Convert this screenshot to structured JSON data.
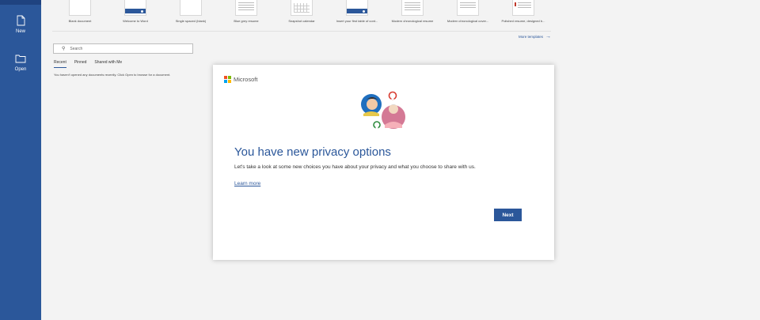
{
  "rail": {
    "items": [
      {
        "label": "New",
        "icon": "new-document-icon"
      },
      {
        "label": "Open",
        "icon": "folder-icon"
      }
    ]
  },
  "templates": {
    "items": [
      {
        "name": "Blank document"
      },
      {
        "name": "Welcome to Word"
      },
      {
        "name": "Single spaced (blank)"
      },
      {
        "name": "Blue grey resume"
      },
      {
        "name": "Snapshot calendar"
      },
      {
        "name": "Insert your first table of cont..."
      },
      {
        "name": "Modern chronological resume"
      },
      {
        "name": "Modern chronological cover..."
      },
      {
        "name": "Polished resume, designed b..."
      }
    ],
    "more_label": "More templates",
    "more_icon": "arrow-right-icon"
  },
  "search": {
    "placeholder": "Search"
  },
  "tabs": [
    {
      "label": "Recent"
    },
    {
      "label": "Pinned"
    },
    {
      "label": "Shared with Me"
    }
  ],
  "empty_message": "You haven't opened any documents recently. Click Open to browse for a document.",
  "dialog": {
    "brand": "Microsoft",
    "title": "You have new privacy options",
    "body": "Let's take a look at some new choices you have about your privacy and what you choose to share with us.",
    "learn_more": "Learn more",
    "next_label": "Next"
  },
  "colors": {
    "accent": "#2b579a",
    "background": "#f3f3f3"
  }
}
